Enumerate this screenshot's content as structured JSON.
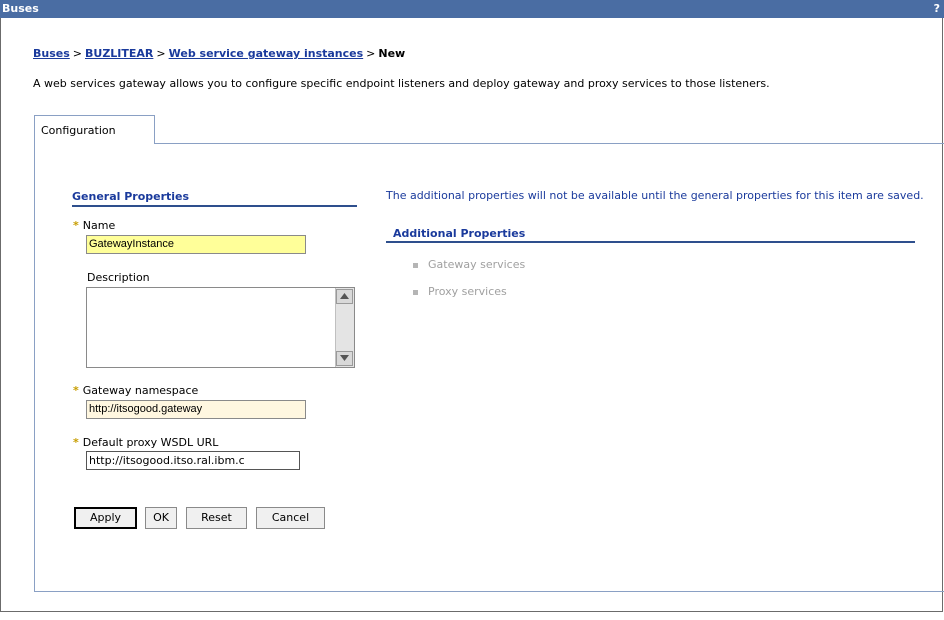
{
  "window": {
    "title": "Buses",
    "help_label": "?"
  },
  "breadcrumb": {
    "items": [
      "Buses",
      "BUZLITEAR",
      "Web service gateway instances"
    ],
    "current": "New",
    "separator": ">"
  },
  "intro_text": "A web services gateway allows you to configure specific endpoint listeners and deploy gateway and proxy services to those listeners.",
  "tabs": [
    {
      "label": "Configuration"
    }
  ],
  "general": {
    "heading": "General Properties",
    "required_marker": "*",
    "name_label": "Name",
    "name_value": "GatewayInstance",
    "description_label": "Description",
    "description_value": "",
    "namespace_label": "Gateway namespace",
    "namespace_value": "http://itsogood.gateway",
    "wsdl_label": "Default proxy WSDL URL",
    "wsdl_value": "http://itsogood.itso.ral.ibm.c"
  },
  "additional": {
    "note": "The additional properties will not be available until the general properties for this item are saved.",
    "heading": "Additional Properties",
    "items": [
      "Gateway services",
      "Proxy services"
    ]
  },
  "buttons": {
    "apply": "Apply",
    "ok": "OK",
    "reset": "Reset",
    "cancel": "Cancel"
  },
  "colors": {
    "titlebar": "#4a6da3",
    "link": "#1a3a9c",
    "required": "#c79d00",
    "field_yellow": "#ffff99"
  }
}
